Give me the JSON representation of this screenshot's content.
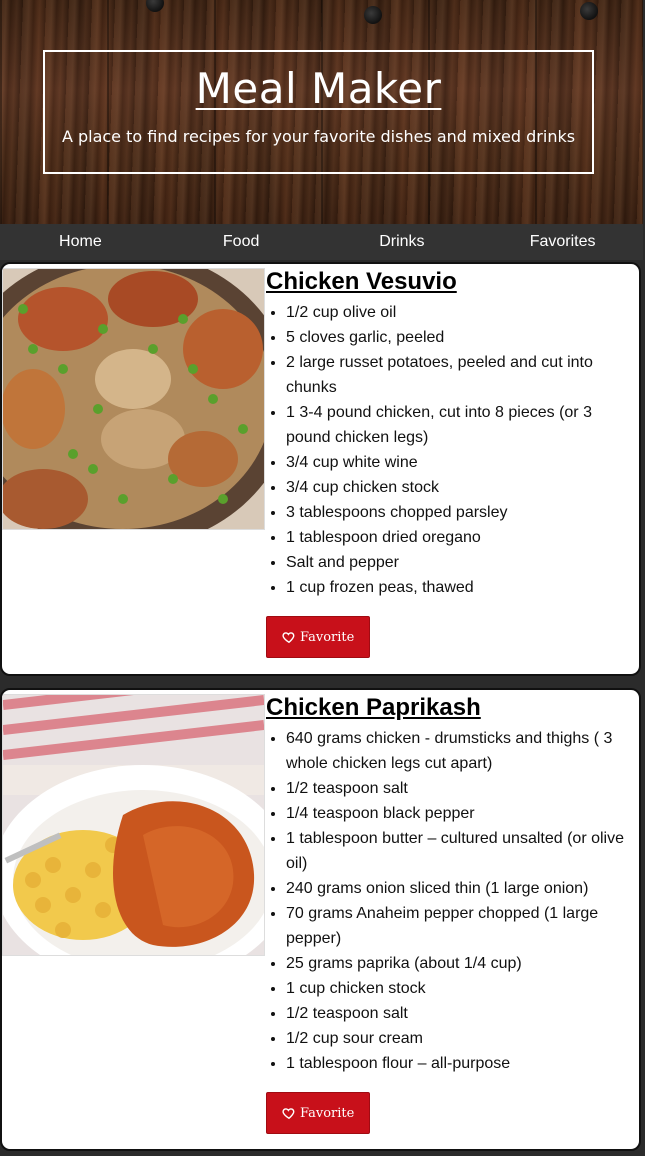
{
  "header": {
    "title": "Meal Maker",
    "subtitle": "A place to find recipes for your favorite dishes and mixed drinks"
  },
  "nav": {
    "items": [
      {
        "label": "Home"
      },
      {
        "label": "Food"
      },
      {
        "label": "Drinks"
      },
      {
        "label": "Favorites"
      }
    ]
  },
  "recipes": [
    {
      "title": "Chicken Vesuvio",
      "image": "chicken-vesuvio-photo",
      "ingredients": [
        "1/2 cup olive oil",
        "5 cloves garlic, peeled",
        "2 large russet potatoes, peeled and cut into chunks",
        "1 3-4 pound chicken, cut into 8 pieces (or 3 pound chicken legs)",
        "3/4 cup white wine",
        "3/4 cup chicken stock",
        "3 tablespoons chopped parsley",
        "1 tablespoon dried oregano",
        "Salt and pepper",
        "1 cup frozen peas, thawed"
      ],
      "favorite_label": "Favorite"
    },
    {
      "title": "Chicken Paprikash",
      "image": "chicken-paprikash-photo",
      "ingredients": [
        "640 grams chicken - drumsticks and thighs ( 3 whole chicken legs cut apart)",
        "1/2 teaspoon salt",
        "1/4 teaspoon black pepper",
        "1 tablespoon butter – cultured unsalted (or olive oil)",
        "240 grams onion sliced thin (1 large onion)",
        "70 grams Anaheim pepper chopped (1 large pepper)",
        "25 grams paprika (about 1/4 cup)",
        "1 cup chicken stock",
        "1/2 teaspoon salt",
        "1/2 cup sour cream",
        "1 tablespoon flour – all-purpose"
      ],
      "favorite_label": "Favorite"
    }
  ],
  "colors": {
    "nav_bg": "#333333",
    "button_bg": "#c8101a",
    "page_bg": "#2b2b2b"
  },
  "icons": {
    "favorite": "heart-outline-icon"
  }
}
